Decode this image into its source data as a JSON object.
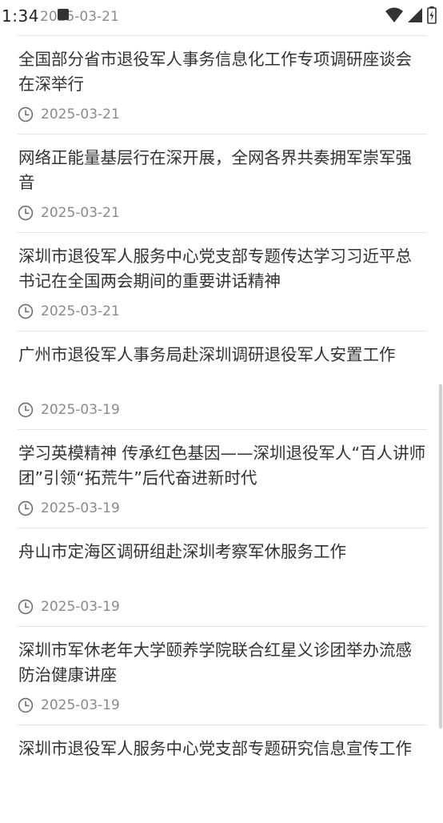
{
  "status_bar": {
    "time": "1:34",
    "date_peek": "2025-03-21",
    "icons": [
      "wifi-icon",
      "signal-icon",
      "battery-icon"
    ]
  },
  "news": [
    {
      "title": "全国部分省市退役军人事务信息化工作专项调研座谈会在深举行",
      "date": "2025-03-21"
    },
    {
      "title": "网络正能量基层行在深开展，全网各界共奏拥军崇军强音",
      "date": "2025-03-21"
    },
    {
      "title": "深圳市退役军人服务中心党支部专题传达学习习近平总书记在全国两会期间的重要讲话精神",
      "date": "2025-03-21"
    },
    {
      "title": "广州市退役军人事务局赴深圳调研退役军人安置工作",
      "date": "2025-03-19"
    },
    {
      "title": "学习英模精神 传承红色基因——深圳退役军人“百人讲师团”引领“拓荒牛”后代奋进新时代",
      "date": "2025-03-19"
    },
    {
      "title": "舟山市定海区调研组赴深圳考察军休服务工作",
      "date": "2025-03-19"
    },
    {
      "title": "深圳市军休老年大学颐养学院联合红星义诊团举办流感防治健康讲座",
      "date": "2025-03-19"
    },
    {
      "title": "深圳市退役军人服务中心党支部专题研究信息宣传工作",
      "date": ""
    }
  ],
  "colors": {
    "title": "#333333",
    "date": "#8a8a8a",
    "divider": "#e6e6e6"
  }
}
